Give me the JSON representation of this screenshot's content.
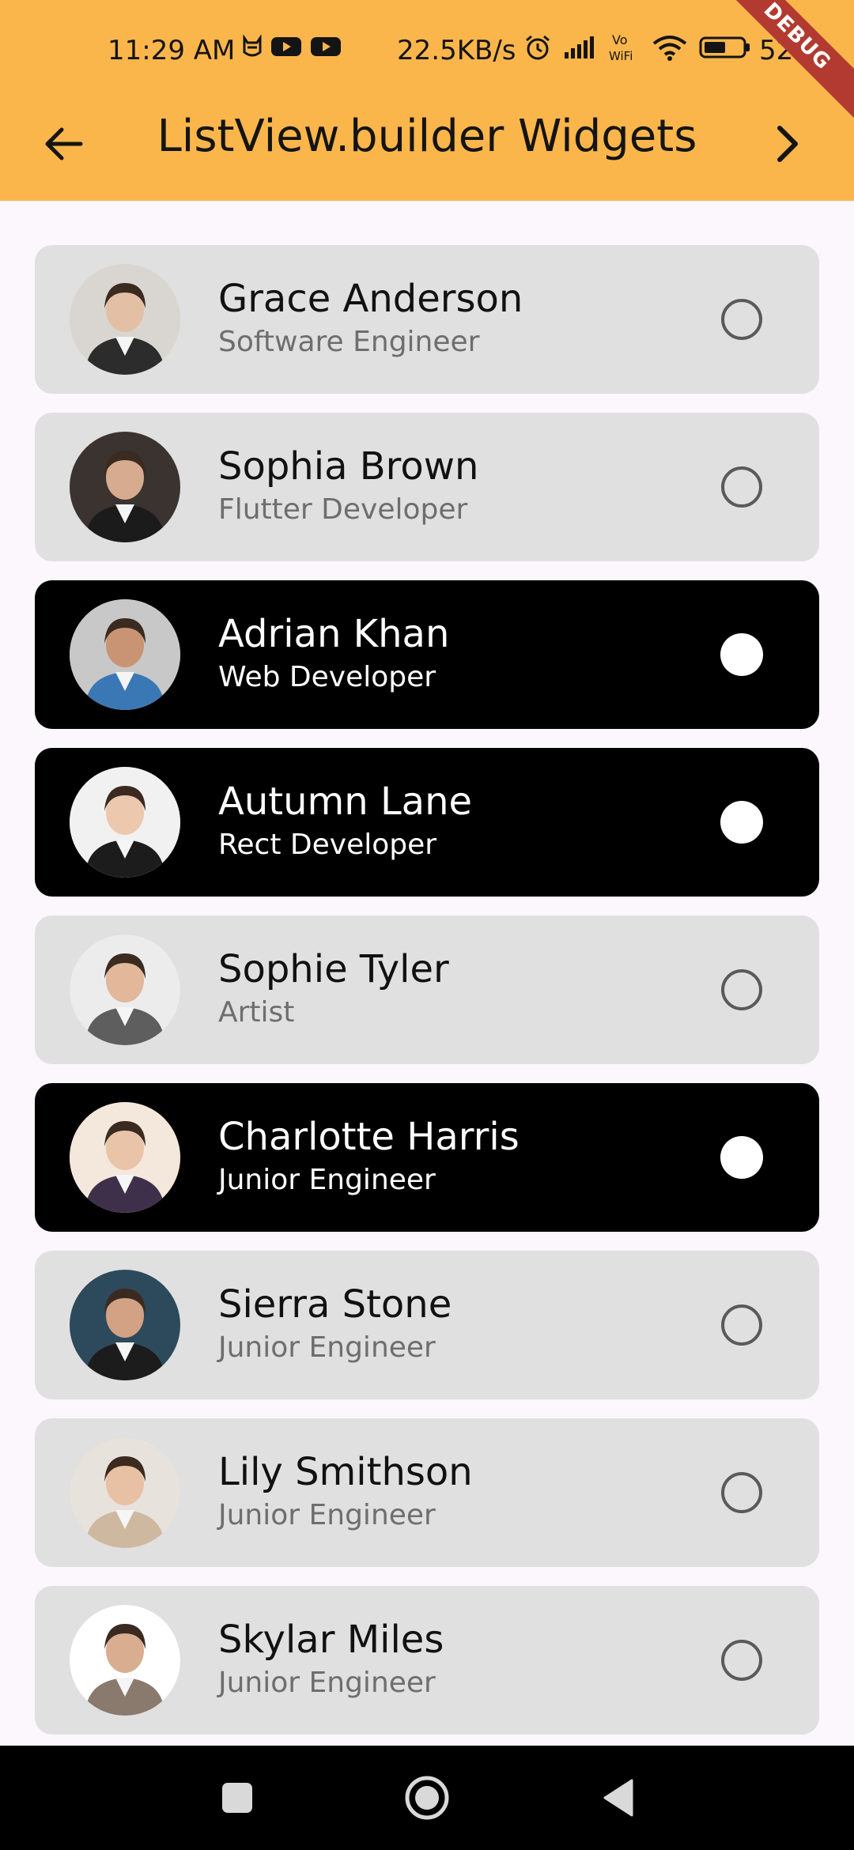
{
  "status_bar": {
    "time": "11:29 AM",
    "net_speed": "22.5KB/s",
    "battery_pct": "52",
    "icons_left": [
      "cat-icon",
      "youtube-icon",
      "youtube-icon"
    ],
    "icons_right": [
      "alarm-icon",
      "signal-icon",
      "vowifi-icon",
      "wifi-icon",
      "battery-icon"
    ]
  },
  "app_bar": {
    "title": "ListView.builder Widgets",
    "back_icon": "arrow-left-icon",
    "next_icon": "chevron-right-icon",
    "background": "#FBB64B"
  },
  "debug_banner": "DEBUG",
  "people": [
    {
      "name": "Grace Anderson",
      "role": "Software Engineer",
      "selected": false
    },
    {
      "name": "Sophia Brown",
      "role": "Flutter Developer",
      "selected": false
    },
    {
      "name": "Adrian Khan",
      "role": "Web Developer",
      "selected": true
    },
    {
      "name": "Autumn Lane",
      "role": "Rect Developer",
      "selected": true
    },
    {
      "name": "Sophie Tyler",
      "role": "Artist",
      "selected": false
    },
    {
      "name": "Charlotte Harris",
      "role": "Junior Engineer",
      "selected": true
    },
    {
      "name": "Sierra Stone",
      "role": "Junior Engineer",
      "selected": false
    },
    {
      "name": "Lily Smithson",
      "role": "Junior Engineer",
      "selected": false
    },
    {
      "name": "Skylar Miles",
      "role": "Junior Engineer",
      "selected": false
    }
  ],
  "nav_bar": {
    "icons": [
      "recents-square-icon",
      "home-circle-icon",
      "back-triangle-icon"
    ]
  },
  "colors": {
    "card_default": "#E0E0E0",
    "card_selected": "#000000",
    "page_background": "#FBF7FC"
  }
}
